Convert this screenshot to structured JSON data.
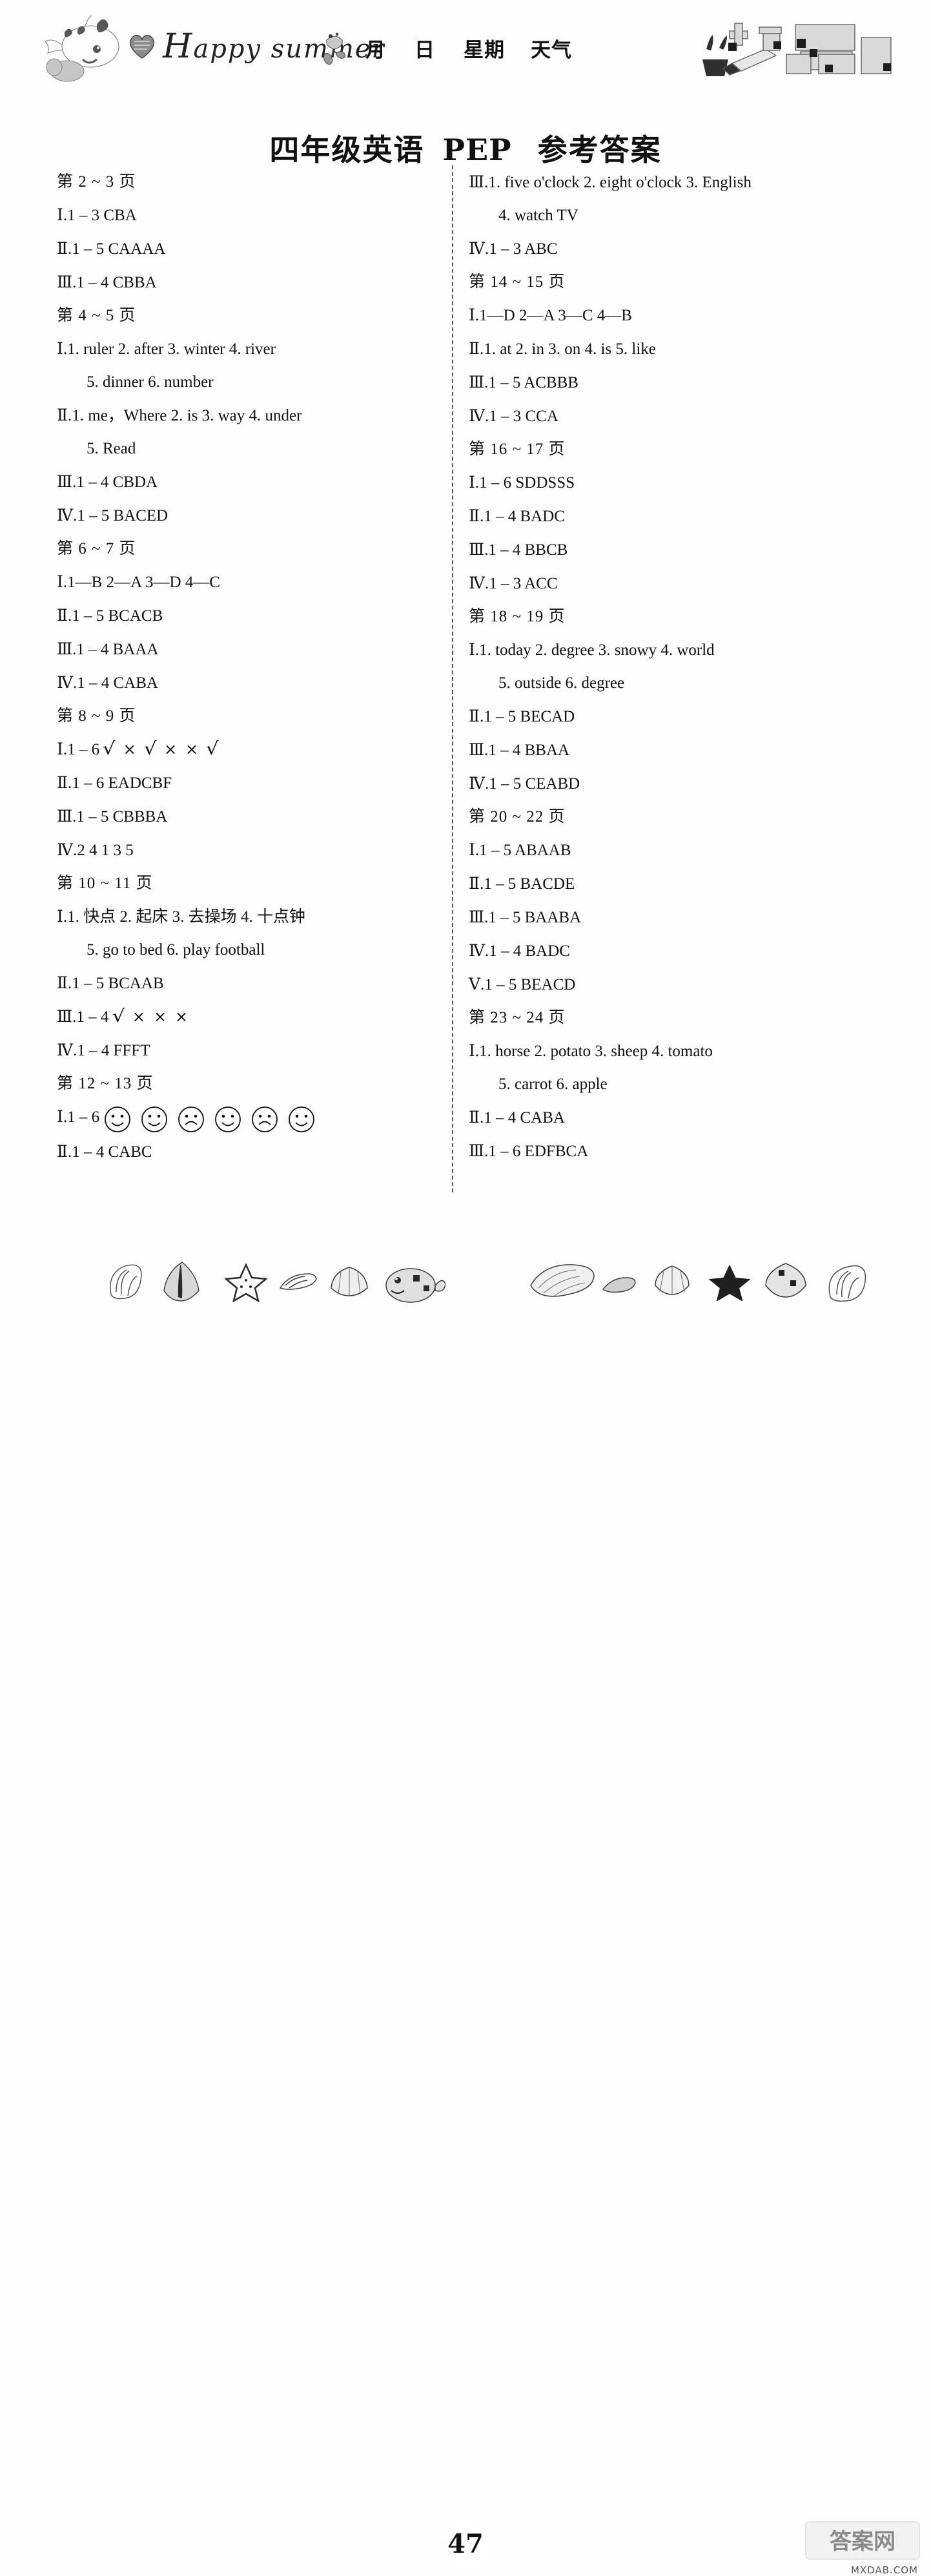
{
  "header": {
    "script_text_cap": "H",
    "script_text_rest": "appy summer",
    "fields": [
      "月",
      "日",
      "星期",
      "天气"
    ],
    "logo_alt": "快乐暑假"
  },
  "title": {
    "grade_subject": "四年级英语",
    "edition": "PEP",
    "label": "参考答案"
  },
  "left_column": [
    {
      "type": "page",
      "text": "第 2 ~ 3 页"
    },
    {
      "type": "answer",
      "num": "Ⅰ",
      "text": ".1 – 3  CBA"
    },
    {
      "type": "answer",
      "num": "Ⅱ",
      "text": ".1 – 5  CAAAA"
    },
    {
      "type": "answer",
      "num": "Ⅲ",
      "text": ".1 – 4  CBBA"
    },
    {
      "type": "page",
      "text": "第 4 ~ 5 页"
    },
    {
      "type": "answer",
      "num": "Ⅰ",
      "text": ".1. ruler   2. after   3. winter   4. river"
    },
    {
      "type": "cont",
      "text": "5. dinner   6. number"
    },
    {
      "type": "answer",
      "num": "Ⅱ",
      "text": ".1. me，Where   2. is   3. way   4. under"
    },
    {
      "type": "cont",
      "text": "5. Read"
    },
    {
      "type": "answer",
      "num": "Ⅲ",
      "text": ".1 – 4  CBDA"
    },
    {
      "type": "answer",
      "num": "Ⅳ",
      "text": ".1 – 5  BACED"
    },
    {
      "type": "page",
      "text": "第 6 ~ 7 页"
    },
    {
      "type": "answer",
      "num": "Ⅰ",
      "text": ".1—B   2—A   3—D   4—C"
    },
    {
      "type": "answer",
      "num": "Ⅱ",
      "text": ".1 – 5  BCACB"
    },
    {
      "type": "answer",
      "num": "Ⅲ",
      "text": ".1 – 4  BAAA"
    },
    {
      "type": "answer",
      "num": "Ⅳ",
      "text": ".1 – 4  CABA"
    },
    {
      "type": "page",
      "text": "第 8 ~ 9 页"
    },
    {
      "type": "marks",
      "num": "Ⅰ",
      "prefix": ".1 – 6 ",
      "marks": [
        "check",
        "cross",
        "check",
        "cross",
        "cross",
        "check"
      ]
    },
    {
      "type": "answer",
      "num": "Ⅱ",
      "text": ".1 – 6  EADCBF"
    },
    {
      "type": "answer",
      "num": "Ⅲ",
      "text": ".1 – 5  CBBBA"
    },
    {
      "type": "answer",
      "num": "Ⅳ",
      "text": ".2   4   1   3   5"
    },
    {
      "type": "page",
      "text": "第 10 ~ 11 页"
    },
    {
      "type": "answer",
      "num": "Ⅰ",
      "text": ".1. 快点   2. 起床   3. 去操场   4. 十点钟"
    },
    {
      "type": "cont",
      "text": "5. go to bed   6. play football"
    },
    {
      "type": "answer",
      "num": "Ⅱ",
      "text": ".1 – 5  BCAAB"
    },
    {
      "type": "marks",
      "num": "Ⅲ",
      "prefix": ".1 – 4 ",
      "marks": [
        "check",
        "cross",
        "cross",
        "cross"
      ]
    },
    {
      "type": "answer",
      "num": "Ⅳ",
      "text": ".1 – 4  FFFT"
    },
    {
      "type": "page",
      "text": "第 12 ~ 13 页"
    },
    {
      "type": "faces",
      "num": "Ⅰ",
      "prefix": ".1 – 6 ",
      "faces": [
        "happy",
        "happy",
        "sad",
        "happy",
        "sad",
        "happy"
      ]
    },
    {
      "type": "answer",
      "num": "Ⅱ",
      "text": ".1 – 4  CABC"
    }
  ],
  "right_column": [
    {
      "type": "answer",
      "num": "Ⅲ",
      "text": ".1. five o'clock   2. eight o'clock   3. English"
    },
    {
      "type": "cont",
      "text": "4. watch TV"
    },
    {
      "type": "answer",
      "num": "Ⅳ",
      "text": ".1 – 3  ABC"
    },
    {
      "type": "page",
      "text": "第 14 ~ 15 页"
    },
    {
      "type": "answer",
      "num": "Ⅰ",
      "text": ".1—D   2—A   3—C   4—B"
    },
    {
      "type": "answer",
      "num": "Ⅱ",
      "text": ".1. at   2. in   3. on   4. is   5. like"
    },
    {
      "type": "answer",
      "num": "Ⅲ",
      "text": ".1 – 5  ACBBB"
    },
    {
      "type": "answer",
      "num": "Ⅳ",
      "text": ".1 – 3  CCA"
    },
    {
      "type": "page",
      "text": "第 16 ~ 17 页"
    },
    {
      "type": "answer",
      "num": "Ⅰ",
      "text": ".1 – 6  SDDSSS"
    },
    {
      "type": "answer",
      "num": "Ⅱ",
      "text": ".1 – 4  BADC"
    },
    {
      "type": "answer",
      "num": "Ⅲ",
      "text": ".1 – 4  BBCB"
    },
    {
      "type": "answer",
      "num": "Ⅳ",
      "text": ".1 – 3  ACC"
    },
    {
      "type": "page",
      "text": "第 18 ~ 19 页"
    },
    {
      "type": "answer",
      "num": "Ⅰ",
      "text": ".1. today   2. degree   3. snowy   4. world"
    },
    {
      "type": "cont",
      "text": "5. outside   6. degree"
    },
    {
      "type": "answer",
      "num": "Ⅱ",
      "text": ".1 – 5  BECAD"
    },
    {
      "type": "answer",
      "num": "Ⅲ",
      "text": ".1 – 4  BBAA"
    },
    {
      "type": "answer",
      "num": "Ⅳ",
      "text": ".1 – 5  CEABD"
    },
    {
      "type": "page",
      "text": "第 20 ~ 22 页"
    },
    {
      "type": "answer",
      "num": "Ⅰ",
      "text": ".1 – 5  ABAAB"
    },
    {
      "type": "answer",
      "num": "Ⅱ",
      "text": ".1 – 5  BACDE"
    },
    {
      "type": "answer",
      "num": "Ⅲ",
      "text": ".1 – 5  BAABA"
    },
    {
      "type": "answer",
      "num": "Ⅳ",
      "text": ".1 – 4  BADC"
    },
    {
      "type": "answer",
      "num": "Ⅴ",
      "text": ".1 – 5  BEACD"
    },
    {
      "type": "page",
      "text": "第 23 ~ 24 页"
    },
    {
      "type": "answer",
      "num": "Ⅰ",
      "text": ".1. horse   2. potato   3. sheep   4. tomato"
    },
    {
      "type": "cont",
      "text": "5. carrot   6. apple"
    },
    {
      "type": "answer",
      "num": "Ⅱ",
      "text": ".1 – 4  CABA"
    },
    {
      "type": "answer",
      "num": "Ⅲ",
      "text": ".1 – 6  EDFBCA"
    }
  ],
  "footer": {
    "page_number": "47",
    "watermark_text": "答案网",
    "watermark_url": "MXDAB.COM"
  }
}
